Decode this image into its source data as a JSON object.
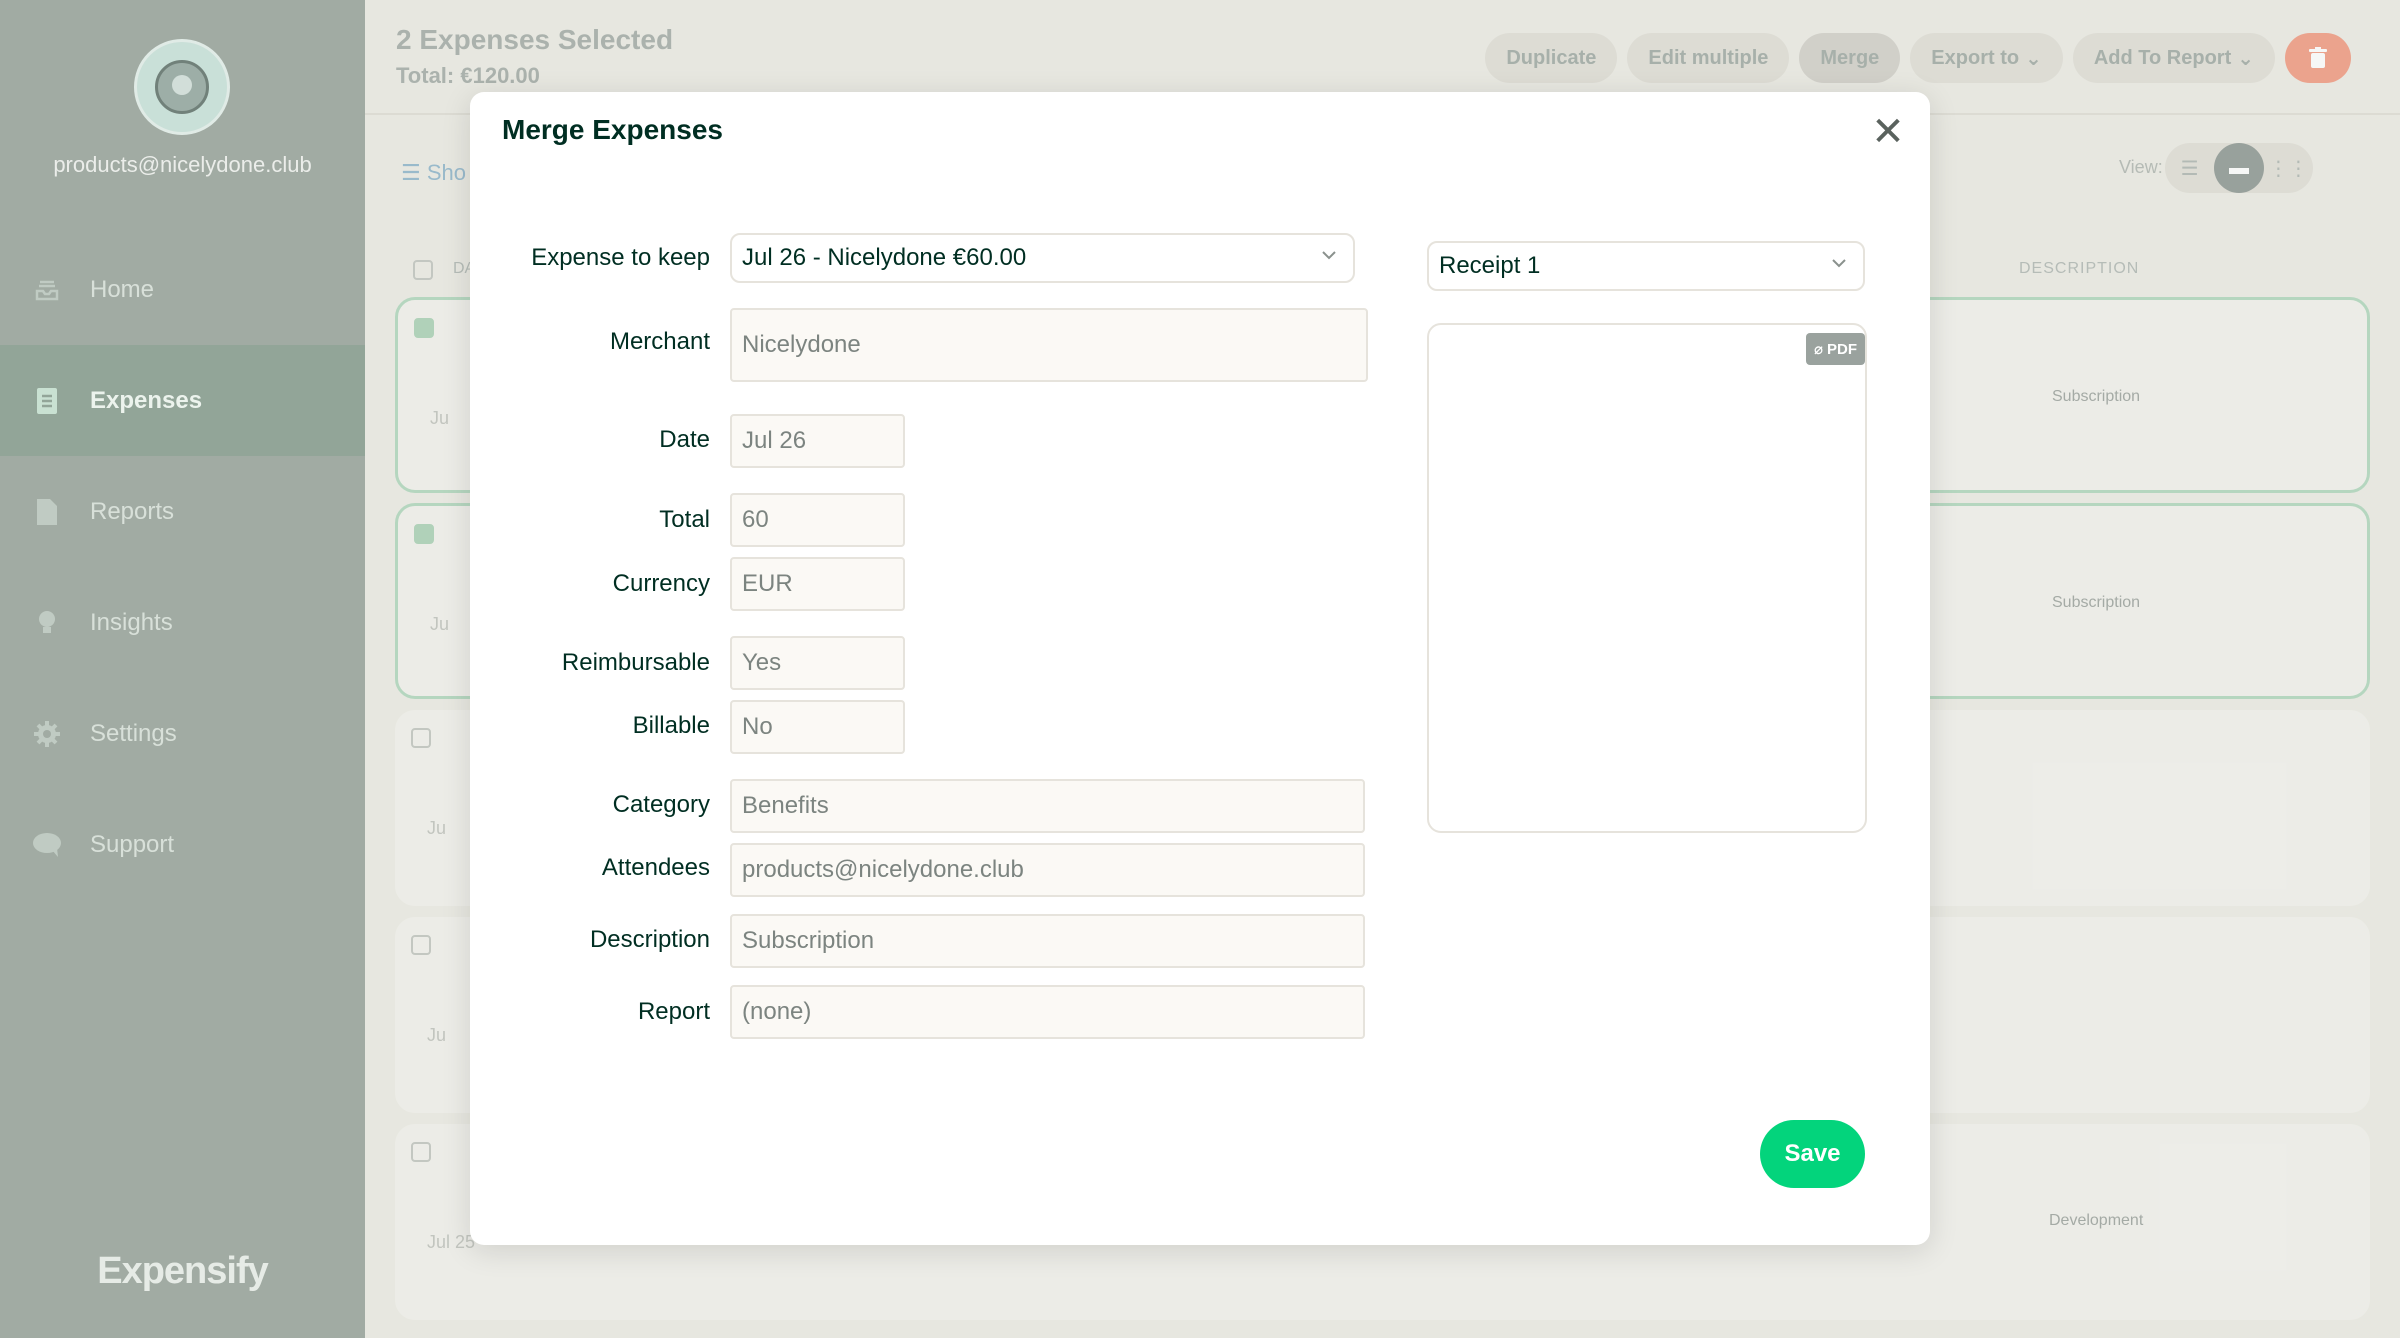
{
  "sidebar": {
    "email": "products@nicelydone.club",
    "items": [
      {
        "label": "Home",
        "icon": "inbox-icon"
      },
      {
        "label": "Expenses",
        "icon": "receipt-icon",
        "active": true
      },
      {
        "label": "Reports",
        "icon": "document-icon"
      },
      {
        "label": "Insights",
        "icon": "lightbulb-icon"
      },
      {
        "label": "Settings",
        "icon": "gear-icon"
      },
      {
        "label": "Support",
        "icon": "chat-icon"
      }
    ],
    "brand": "Expensify"
  },
  "header": {
    "selected_title": "2 Expenses Selected",
    "total": "Total: €120.00",
    "actions": {
      "duplicate": "Duplicate",
      "edit_multiple": "Edit multiple",
      "merge": "Merge",
      "export_to": "Export to",
      "add_to_report": "Add To Report"
    }
  },
  "toolbar": {
    "filter_link": "Sho",
    "view_label": "View:"
  },
  "table": {
    "date_header": "DA",
    "description_header": "DESCRIPTION",
    "rows": [
      {
        "selected": true,
        "date": "Ju",
        "description": "Subscription"
      },
      {
        "selected": true,
        "date": "Ju",
        "description": "Subscription"
      },
      {
        "selected": false,
        "date": "Ju",
        "description": ""
      },
      {
        "selected": false,
        "date": "Ju",
        "description": ""
      },
      {
        "selected": false,
        "date": "Jul 25",
        "description": "Development"
      }
    ]
  },
  "modal": {
    "title": "Merge Expenses",
    "expense_to_keep": {
      "label": "Expense to keep",
      "value": "Jul 26 - Nicelydone €60.00"
    },
    "merchant": {
      "label": "Merchant",
      "value": "Nicelydone"
    },
    "date": {
      "label": "Date",
      "value": "Jul 26"
    },
    "total": {
      "label": "Total",
      "value": "60"
    },
    "currency": {
      "label": "Currency",
      "value": "EUR"
    },
    "reimbursable": {
      "label": "Reimbursable",
      "value": "Yes"
    },
    "billable": {
      "label": "Billable",
      "value": "No"
    },
    "category": {
      "label": "Category",
      "value": "Benefits"
    },
    "attendees": {
      "label": "Attendees",
      "value": "products@nicelydone.club"
    },
    "description": {
      "label": "Description",
      "value": "Subscription"
    },
    "report": {
      "label": "Report",
      "value": "(none)"
    },
    "receipt_select": "Receipt 1",
    "pdf_badge": "PDF",
    "save_label": "Save"
  },
  "colors": {
    "accent_green": "#03d47c",
    "sidebar_bg": "#a3ada5",
    "delete_red": "#f3a48e"
  }
}
